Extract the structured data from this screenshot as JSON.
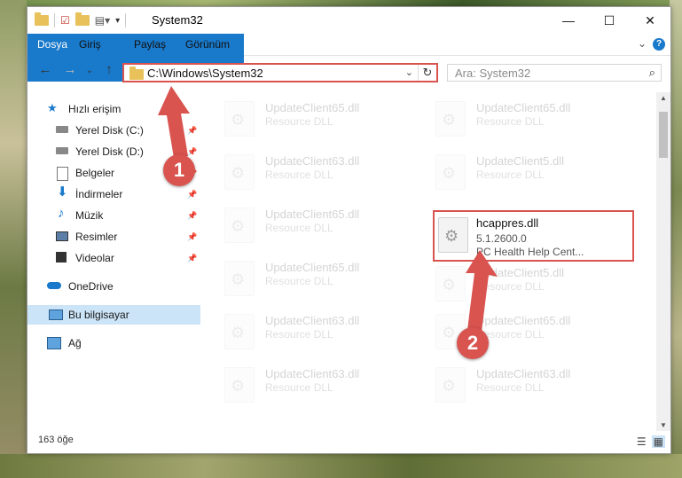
{
  "window": {
    "title": "System32"
  },
  "ribbon": {
    "tabs": [
      "Dosya",
      "Giriş",
      "Paylaş",
      "Görünüm"
    ],
    "help": "?"
  },
  "nav": {
    "address": "C:\\Windows\\System32",
    "search_placeholder": "Ara: System32"
  },
  "sidebar": {
    "items": [
      {
        "label": "Hızlı erişim",
        "icon": "star-icon"
      },
      {
        "label": "Yerel Disk (C:)",
        "icon": "drive-icon",
        "pinned": true
      },
      {
        "label": "Yerel Disk (D:)",
        "icon": "drive-icon",
        "pinned": true
      },
      {
        "label": "Belgeler",
        "icon": "documents-icon",
        "pinned": true
      },
      {
        "label": "İndirmeler",
        "icon": "download-icon",
        "pinned": true
      },
      {
        "label": "Müzik",
        "icon": "music-icon",
        "pinned": true
      },
      {
        "label": "Resimler",
        "icon": "pictures-icon",
        "pinned": true
      },
      {
        "label": "Videolar",
        "icon": "videos-icon",
        "pinned": true
      },
      {
        "label": "OneDrive",
        "icon": "cloud-icon"
      },
      {
        "label": "Bu bilgisayar",
        "icon": "computer-icon",
        "selected": true
      },
      {
        "label": "Ağ",
        "icon": "network-icon"
      }
    ]
  },
  "files": {
    "left": [
      {
        "name": "UpdateClient65.dll",
        "type": "Resource DLL"
      },
      {
        "name": "UpdateClient63.dll",
        "type": "Resource DLL"
      },
      {
        "name": "UpdateClient65.dll",
        "type": "Resource DLL"
      },
      {
        "name": "UpdateClient65.dll",
        "type": "Resource DLL"
      },
      {
        "name": "UpdateClient63.dll",
        "type": "Resource DLL"
      },
      {
        "name": "UpdateClient63.dll",
        "type": "Resource DLL"
      }
    ],
    "right": [
      {
        "name": "UpdateClient65.dll",
        "type": "Resource DLL"
      },
      {
        "name": "UpdateClient5.dll",
        "type": "Resource DLL"
      },
      {
        "name": "hcappres.dll",
        "version": "5.1.2600.0",
        "type": "PC Health Help Cent...",
        "highlighted": true
      },
      {
        "name": "UpdateClient5.dll",
        "type": "Resource DLL"
      },
      {
        "name": "UpdateClient65.dll",
        "type": "Resource DLL"
      },
      {
        "name": "UpdateClient63.dll",
        "type": "Resource DLL"
      }
    ]
  },
  "status": {
    "count": "163 öğe"
  },
  "markers": [
    "1",
    "2"
  ],
  "colors": {
    "accent": "#1979ca",
    "annotation": "#d9534f"
  }
}
